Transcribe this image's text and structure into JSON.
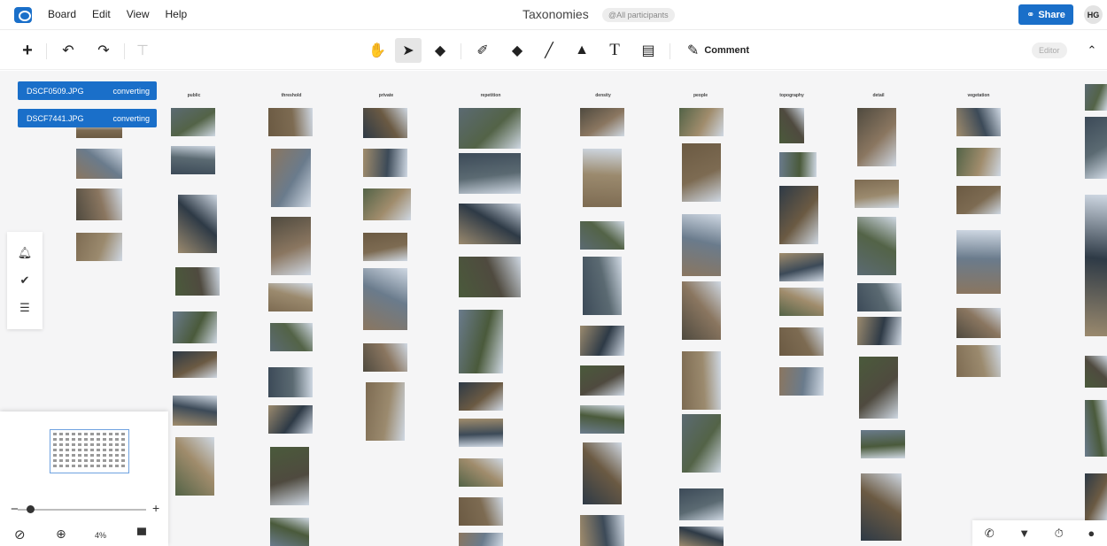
{
  "menubar": {
    "menu_items": [
      "Board",
      "Edit",
      "View",
      "Help"
    ],
    "title": "Taxonomies",
    "participants": "@All participants",
    "share_label": "Share",
    "avatar_initials": "HG"
  },
  "toolbar": {
    "comment_label": "Comment",
    "editor_label": "Editor",
    "tools": [
      "add-icon",
      "undo-icon",
      "redo-icon",
      "format-painter-icon",
      "hand-pan-icon",
      "select-pointer-icon",
      "eraser-icon",
      "pen-icon",
      "highlighter-icon",
      "line-icon",
      "shape-icon",
      "text-icon",
      "sticky-note-icon",
      "comment-icon",
      "collapse-icon"
    ]
  },
  "uploads": [
    {
      "filename": "DSCF0509.JPG",
      "status": "converting"
    },
    {
      "filename": "DSCF7441.JPG",
      "status": "converting"
    }
  ],
  "columns": [
    {
      "label": "public"
    },
    {
      "label": "threshold"
    },
    {
      "label": "private"
    },
    {
      "label": "repetition"
    },
    {
      "label": "density"
    },
    {
      "label": "people"
    },
    {
      "label": "topography"
    },
    {
      "label": "detail"
    },
    {
      "label": "vegetation"
    }
  ],
  "left_panel": {
    "icons": [
      "notification-bell-icon",
      "check-circle-icon",
      "list-icon"
    ]
  },
  "minimap": {
    "zoom_level": "4%",
    "minus_label": "−",
    "plus_label": "+"
  },
  "bottom_right": {
    "icons": [
      "phone-icon",
      "screen-share-icon",
      "timer-icon",
      "chat-icon"
    ]
  },
  "colors": {
    "accent": "#1a6fc9",
    "canvas": "#f5f5f6"
  }
}
